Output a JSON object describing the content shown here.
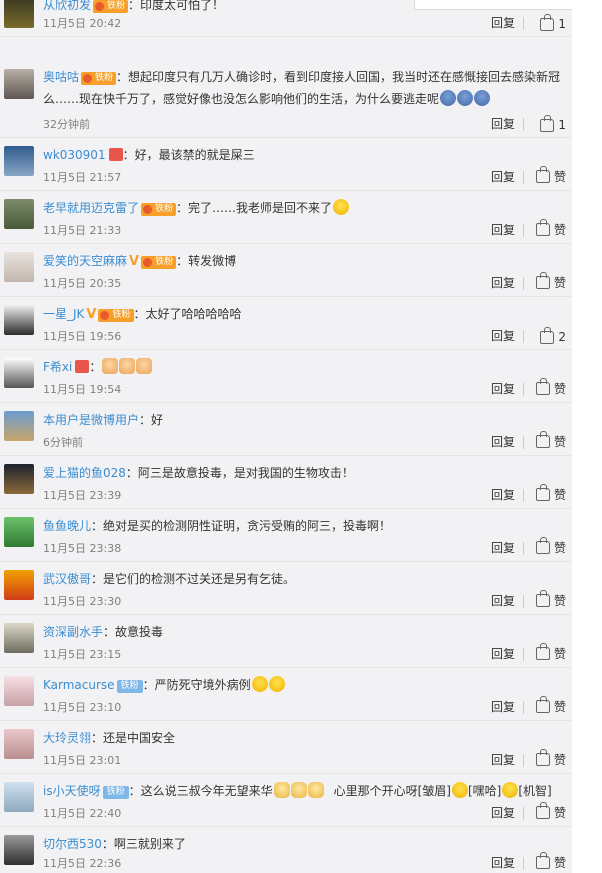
{
  "comments": [
    {
      "user": "从欣初发",
      "fan_badge": "铁粉",
      "text": "：印度太可怕了！",
      "time": "11月5日 20:42",
      "reply": "回复",
      "likes": "1"
    },
    {
      "user": "奥咕咕",
      "fan_badge": "铁粉",
      "text": "：想起印度只有几万人确诊时，看到印度接人回国，我当时还在感慨接回去感染新冠么……现在快千万了，感觉好像也没怎么影响他们的生活，为什么要逃走呢",
      "time": "32分钟前",
      "reply": "回复",
      "likes": "1"
    },
    {
      "user": "wk030901",
      "text": "：好，最该禁的就是屎三",
      "time": "11月5日 21:57",
      "reply": "回复",
      "likes": "赞"
    },
    {
      "user": "老早就用迈克雷了",
      "fan_badge": "铁粉",
      "text": "：完了……我老师是回不来了",
      "time": "11月5日 21:33",
      "reply": "回复",
      "likes": "赞"
    },
    {
      "user": "爱笑的天空麻麻",
      "fan_badge": "铁粉",
      "text": "：转发微博",
      "time": "11月5日 20:35",
      "reply": "回复",
      "likes": "赞"
    },
    {
      "user": "一星_JK",
      "fan_badge": "铁粉",
      "text": "：太好了哈哈哈哈哈",
      "time": "11月5日 19:56",
      "reply": "回复",
      "likes": "2"
    },
    {
      "user": "F希xi",
      "text": "：",
      "time": "11月5日 19:54",
      "reply": "回复",
      "likes": "赞"
    },
    {
      "user": "本用户是微博用户",
      "text": "：好",
      "time": "6分钟前",
      "reply": "回复",
      "likes": "赞"
    },
    {
      "user": "爱上猫的鱼028",
      "text": "：阿三是故意投毒，是对我国的生物攻击！",
      "time": "11月5日 23:39",
      "reply": "回复",
      "likes": "赞"
    },
    {
      "user": "鱼鱼晚儿",
      "text": "：绝对是买的检测阴性证明，贪污受贿的阿三，投毒啊！",
      "time": "11月5日 23:38",
      "reply": "回复",
      "likes": "赞"
    },
    {
      "user": "武汉傲哥",
      "text": "：是它们的检测不过关还是另有乞徒。",
      "time": "11月5日 23:30",
      "reply": "回复",
      "likes": "赞"
    },
    {
      "user": "资深副水手",
      "text": "：故意投毒",
      "time": "11月5日 23:15",
      "reply": "回复",
      "likes": "赞"
    },
    {
      "user": "Karmacurse",
      "fan_badge": "铁粉",
      "text": "：严防死守境外病例",
      "time": "11月5日 23:10",
      "reply": "回复",
      "likes": "赞"
    },
    {
      "user": "大玲灵翎",
      "text": "：还是中国安全",
      "time": "11月5日 23:01",
      "reply": "回复",
      "likes": "赞"
    },
    {
      "user": "is小天使呀",
      "fan_badge": "铁粉",
      "text": "：这么说三叔今年无望来华",
      "text2": "心里那个开心呀[皱眉]",
      "text3": "[嘿哈]",
      "text4": "[机智]",
      "time": "11月5日 22:40",
      "reply": "回复",
      "likes": "赞"
    },
    {
      "user": "切尔西530",
      "text": "：啊三就别来了",
      "time": "11月5日 22:36",
      "reply": "回复",
      "likes": "赞"
    }
  ],
  "topbar_glyph": "⊞ ^"
}
